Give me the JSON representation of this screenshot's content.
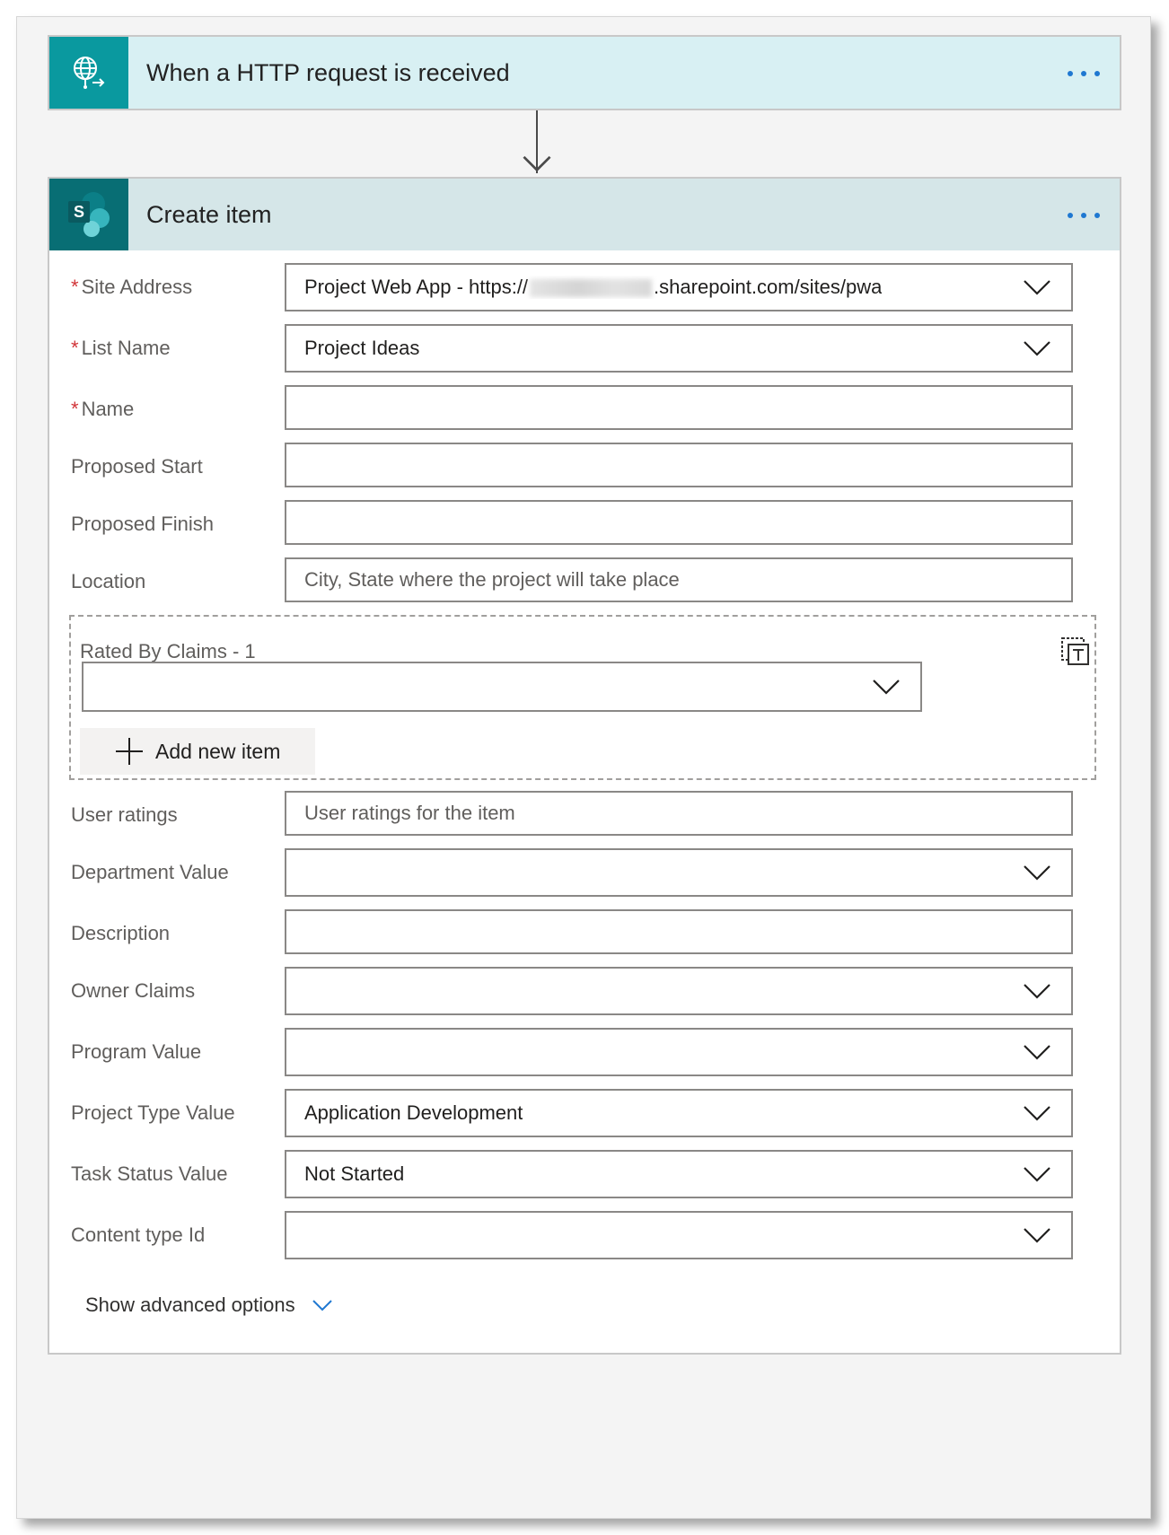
{
  "trigger": {
    "title": "When a HTTP request is received",
    "icon": "globe-request-icon",
    "accent": "#0a999f"
  },
  "action": {
    "title": "Create item",
    "icon": "sharepoint-icon",
    "icon_letter": "S",
    "accent": "#086e74"
  },
  "fields": {
    "site_address": {
      "label": "Site Address",
      "required": "*",
      "value_prefix": "Project Web App - https://",
      "value_suffix": ".sharepoint.com/sites/pwa"
    },
    "list_name": {
      "label": "List Name",
      "required": "*",
      "value": "Project Ideas"
    },
    "name": {
      "label": "Name",
      "required": "*",
      "value": ""
    },
    "proposed_start": {
      "label": "Proposed Start",
      "value": ""
    },
    "proposed_finish": {
      "label": "Proposed Finish",
      "value": ""
    },
    "location": {
      "label": "Location",
      "placeholder": "City, State where the project will take place"
    },
    "rated_by_claims": {
      "label": "Rated By Claims - 1",
      "add_label": "Add new item"
    },
    "user_ratings": {
      "label": "User ratings",
      "placeholder": "User ratings for the item"
    },
    "department_value": {
      "label": "Department Value",
      "value": ""
    },
    "description": {
      "label": "Description",
      "value": ""
    },
    "owner_claims": {
      "label": "Owner Claims",
      "value": ""
    },
    "program_value": {
      "label": "Program Value",
      "value": ""
    },
    "project_type_value": {
      "label": "Project Type Value",
      "value": "Application Development"
    },
    "task_status_value": {
      "label": "Task Status Value",
      "value": "Not Started"
    },
    "content_type_id": {
      "label": "Content type Id",
      "value": ""
    }
  },
  "advanced_options": "Show advanced options",
  "colors": {
    "link_blue": "#1f78d1",
    "required_red": "#d13438",
    "trigger_header": "#d8f0f3",
    "action_header": "#d5e6e8"
  }
}
